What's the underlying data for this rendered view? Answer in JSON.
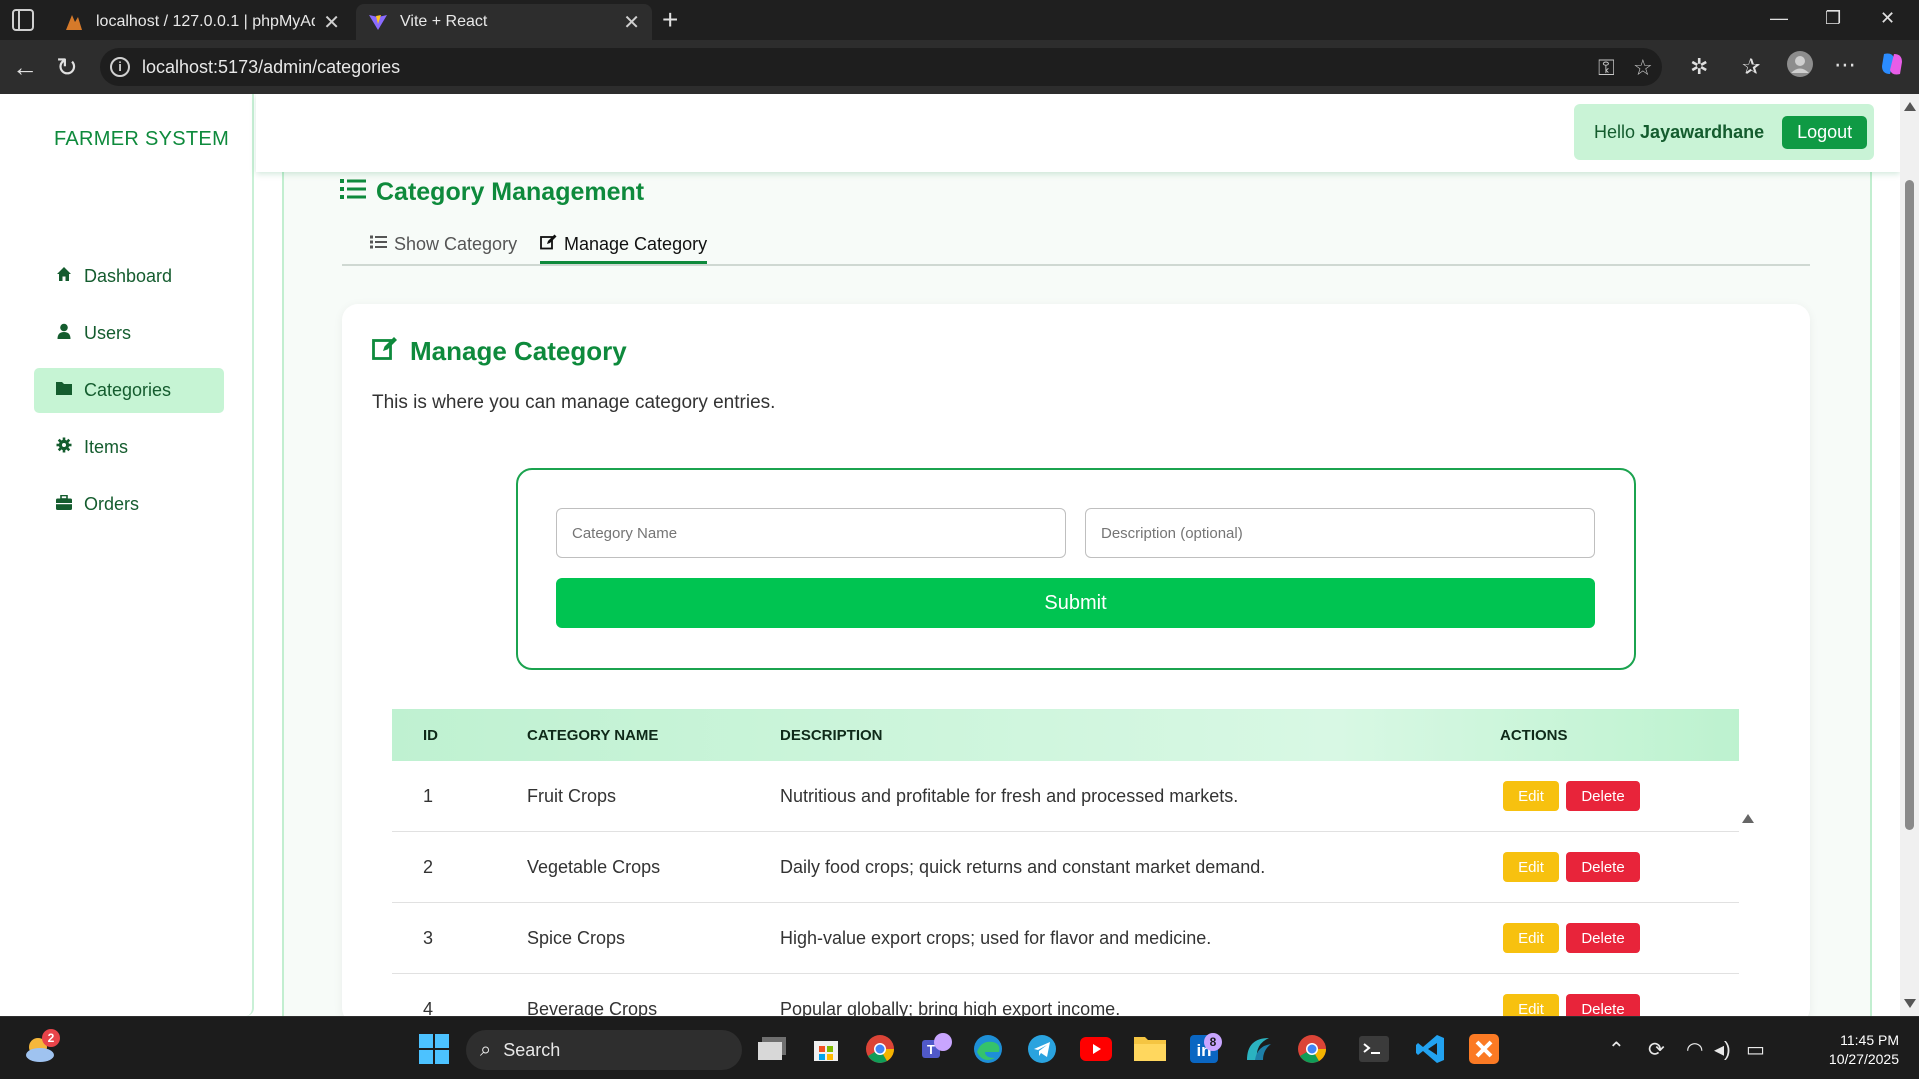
{
  "browser": {
    "tabs": [
      {
        "title": "localhost / 127.0.0.1 | phpMyAdm",
        "active": false
      },
      {
        "title": "Vite + React",
        "active": true
      }
    ],
    "url": "localhost:5173/admin/categories"
  },
  "sidebar": {
    "brand": "FARMER SYSTEM",
    "items": [
      {
        "label": "Dashboard",
        "icon": "home-icon",
        "active": false
      },
      {
        "label": "Users",
        "icon": "user-icon",
        "active": false
      },
      {
        "label": "Categories",
        "icon": "folder-icon",
        "active": true
      },
      {
        "label": "Items",
        "icon": "gear-icon",
        "active": false
      },
      {
        "label": "Orders",
        "icon": "briefcase-icon",
        "active": false
      }
    ]
  },
  "topbar": {
    "greeting": "Hello",
    "username": "Jayawardhane",
    "logout_label": "Logout"
  },
  "page": {
    "title": "Category Management",
    "tabs": [
      {
        "label": "Show Category",
        "active": false
      },
      {
        "label": "Manage Category",
        "active": true
      }
    ],
    "section_title": "Manage Category",
    "section_desc": "This is where you can manage category entries."
  },
  "form": {
    "name_placeholder": "Category Name",
    "desc_placeholder": "Description (optional)",
    "submit_label": "Submit"
  },
  "table": {
    "headers": [
      "ID",
      "CATEGORY NAME",
      "DESCRIPTION",
      "ACTIONS"
    ],
    "rows": [
      {
        "id": "1",
        "name": "Fruit Crops",
        "desc": "Nutritious and profitable for fresh and processed markets."
      },
      {
        "id": "2",
        "name": "Vegetable Crops",
        "desc": "Daily food crops; quick returns and constant market demand."
      },
      {
        "id": "3",
        "name": "Spice Crops",
        "desc": "High-value export crops; used for flavor and medicine."
      },
      {
        "id": "4",
        "name": "Beverage Crops",
        "desc": "Popular globally; bring high export income."
      }
    ],
    "edit_label": "Edit",
    "delete_label": "Delete"
  },
  "taskbar": {
    "search_label": "Search",
    "weather_badge": "2",
    "linkedin_badge": "8",
    "time": "11:45 PM",
    "date": "10/27/2025"
  },
  "colors": {
    "brand_green": "#0e8a3c",
    "submit_green": "#00c451",
    "edit_yellow": "#f7c10f",
    "delete_red": "#e8243a"
  }
}
